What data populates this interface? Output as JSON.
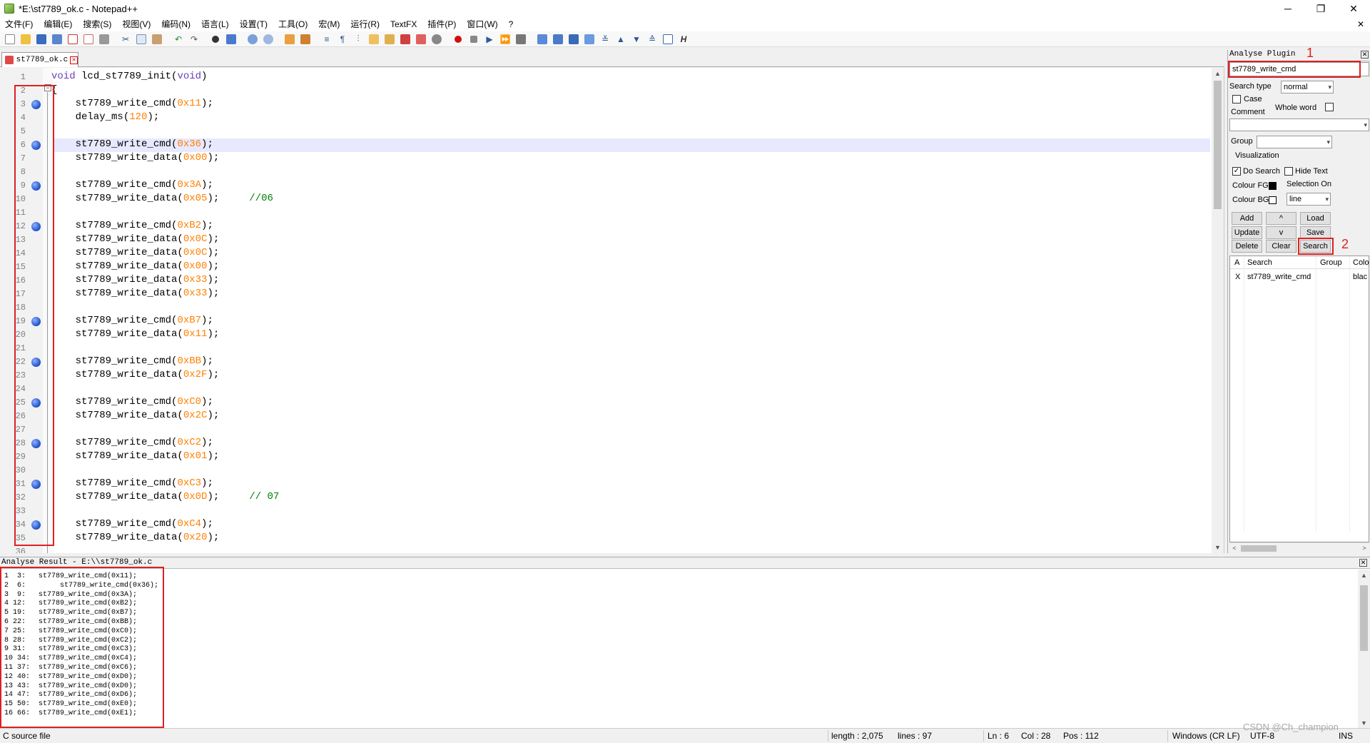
{
  "window": {
    "title": "*E:\\st7789_ok.c - Notepad++",
    "minimize": "─",
    "maximize": "❐",
    "close": "✕"
  },
  "menu": [
    "文件(F)",
    "编辑(E)",
    "搜索(S)",
    "视图(V)",
    "编码(N)",
    "语言(L)",
    "设置(T)",
    "工具(O)",
    "宏(M)",
    "运行(R)",
    "TextFX",
    "插件(P)",
    "窗口(W)",
    "?"
  ],
  "menu_close": "✕",
  "tab": {
    "label": "st7789_ok.c",
    "close": "✕"
  },
  "editor": {
    "fold_marker": "−",
    "lines": [
      {
        "n": "1",
        "code": [
          [
            "kw",
            "void"
          ],
          [
            "t",
            " lcd_st7789_init("
          ],
          [
            "kw",
            "void"
          ],
          [
            "t",
            ")"
          ]
        ]
      },
      {
        "n": "2",
        "code": [
          [
            "t",
            "{"
          ]
        ]
      },
      {
        "n": "3",
        "bm": true,
        "code": [
          [
            "t",
            "    st7789_write_cmd("
          ],
          [
            "num",
            "0x11"
          ],
          [
            "t",
            ");"
          ]
        ]
      },
      {
        "n": "4",
        "code": [
          [
            "t",
            "    delay_ms("
          ],
          [
            "num",
            "120"
          ],
          [
            "t",
            ");"
          ]
        ]
      },
      {
        "n": "5",
        "code": []
      },
      {
        "n": "6",
        "bm": true,
        "current": true,
        "code": [
          [
            "t",
            "    st7789_write_cmd("
          ],
          [
            "num",
            "0x36"
          ],
          [
            "t",
            ");"
          ]
        ]
      },
      {
        "n": "7",
        "code": [
          [
            "t",
            "    st7789_write_data("
          ],
          [
            "num",
            "0x00"
          ],
          [
            "t",
            ");"
          ]
        ]
      },
      {
        "n": "8",
        "code": []
      },
      {
        "n": "9",
        "bm": true,
        "code": [
          [
            "t",
            "    st7789_write_cmd("
          ],
          [
            "num",
            "0x3A"
          ],
          [
            "t",
            ");"
          ]
        ]
      },
      {
        "n": "10",
        "code": [
          [
            "t",
            "    st7789_write_data("
          ],
          [
            "num",
            "0x05"
          ],
          [
            "t",
            ");     "
          ],
          [
            "cm",
            "//06"
          ]
        ]
      },
      {
        "n": "11",
        "code": []
      },
      {
        "n": "12",
        "bm": true,
        "code": [
          [
            "t",
            "    st7789_write_cmd("
          ],
          [
            "num",
            "0xB2"
          ],
          [
            "t",
            ");"
          ]
        ]
      },
      {
        "n": "13",
        "code": [
          [
            "t",
            "    st7789_write_data("
          ],
          [
            "num",
            "0x0C"
          ],
          [
            "t",
            ");"
          ]
        ]
      },
      {
        "n": "14",
        "code": [
          [
            "t",
            "    st7789_write_data("
          ],
          [
            "num",
            "0x0C"
          ],
          [
            "t",
            ");"
          ]
        ]
      },
      {
        "n": "15",
        "code": [
          [
            "t",
            "    st7789_write_data("
          ],
          [
            "num",
            "0x00"
          ],
          [
            "t",
            ");"
          ]
        ]
      },
      {
        "n": "16",
        "code": [
          [
            "t",
            "    st7789_write_data("
          ],
          [
            "num",
            "0x33"
          ],
          [
            "t",
            ");"
          ]
        ]
      },
      {
        "n": "17",
        "code": [
          [
            "t",
            "    st7789_write_data("
          ],
          [
            "num",
            "0x33"
          ],
          [
            "t",
            ");"
          ]
        ]
      },
      {
        "n": "18",
        "code": []
      },
      {
        "n": "19",
        "bm": true,
        "code": [
          [
            "t",
            "    st7789_write_cmd("
          ],
          [
            "num",
            "0xB7"
          ],
          [
            "t",
            ");"
          ]
        ]
      },
      {
        "n": "20",
        "code": [
          [
            "t",
            "    st7789_write_data("
          ],
          [
            "num",
            "0x11"
          ],
          [
            "t",
            ");"
          ]
        ]
      },
      {
        "n": "21",
        "code": []
      },
      {
        "n": "22",
        "bm": true,
        "code": [
          [
            "t",
            "    st7789_write_cmd("
          ],
          [
            "num",
            "0xBB"
          ],
          [
            "t",
            ");"
          ]
        ]
      },
      {
        "n": "23",
        "code": [
          [
            "t",
            "    st7789_write_data("
          ],
          [
            "num",
            "0x2F"
          ],
          [
            "t",
            ");"
          ]
        ]
      },
      {
        "n": "24",
        "code": []
      },
      {
        "n": "25",
        "bm": true,
        "code": [
          [
            "t",
            "    st7789_write_cmd("
          ],
          [
            "num",
            "0xC0"
          ],
          [
            "t",
            ");"
          ]
        ]
      },
      {
        "n": "26",
        "code": [
          [
            "t",
            "    st7789_write_data("
          ],
          [
            "num",
            "0x2C"
          ],
          [
            "t",
            ");"
          ]
        ]
      },
      {
        "n": "27",
        "code": []
      },
      {
        "n": "28",
        "bm": true,
        "code": [
          [
            "t",
            "    st7789_write_cmd("
          ],
          [
            "num",
            "0xC2"
          ],
          [
            "t",
            ");"
          ]
        ]
      },
      {
        "n": "29",
        "code": [
          [
            "t",
            "    st7789_write_data("
          ],
          [
            "num",
            "0x01"
          ],
          [
            "t",
            ");"
          ]
        ]
      },
      {
        "n": "30",
        "code": []
      },
      {
        "n": "31",
        "bm": true,
        "code": [
          [
            "t",
            "    st7789_write_cmd("
          ],
          [
            "num",
            "0xC3"
          ],
          [
            "t",
            ");"
          ]
        ]
      },
      {
        "n": "32",
        "code": [
          [
            "t",
            "    st7789_write_data("
          ],
          [
            "num",
            "0x0D"
          ],
          [
            "t",
            ");     "
          ],
          [
            "cm",
            "// 07"
          ]
        ]
      },
      {
        "n": "33",
        "code": []
      },
      {
        "n": "34",
        "bm": true,
        "code": [
          [
            "t",
            "    st7789_write_cmd("
          ],
          [
            "num",
            "0xC4"
          ],
          [
            "t",
            ");"
          ]
        ]
      },
      {
        "n": "35",
        "code": [
          [
            "t",
            "    st7789_write_data("
          ],
          [
            "num",
            "0x20"
          ],
          [
            "t",
            ");"
          ]
        ]
      },
      {
        "n": "36",
        "code": []
      }
    ]
  },
  "plugin": {
    "title": "Analyse Plugin",
    "close": "✕",
    "search_value": "st7789_write_cmd",
    "search_type_label": "Search type",
    "search_type_value": "normal",
    "case_label": "Case",
    "whole_word_label": "Whole word",
    "comment_label": "Comment",
    "comment_value": "",
    "group_label": "Group",
    "group_value": "",
    "visualization_label": "Visualization",
    "do_search_label": "Do Search",
    "do_search_checked": "✓",
    "hide_text_label": "Hide Text",
    "colour_fg_label": "Colour FG",
    "colour_fg": "#000000",
    "selection_on_label": "Selection On",
    "colour_bg_label": "Colour BG",
    "colour_bg": "#ffffff",
    "selection_value": "line",
    "buttons": {
      "add": "Add",
      "up": "^",
      "load": "Load",
      "update": "Update",
      "down": "v",
      "save": "Save",
      "delete": "Delete",
      "clear": "Clear",
      "search": "Search"
    },
    "list_headers": {
      "a": "A",
      "search": "Search",
      "group": "Group",
      "colour": "Colo"
    },
    "list_rows": [
      {
        "a": "X",
        "search": "st7789_write_cmd",
        "group": "",
        "colour": "blac"
      }
    ],
    "scroll_left": "<",
    "scroll_right": ">",
    "annotation_1": "1",
    "annotation_2": "2"
  },
  "results": {
    "title": "Analyse Result - E:\\\\st7789_ok.c",
    "close": "✕",
    "rows": [
      "1  3:   st7789_write_cmd(0x11);",
      "2  6:        st7789_write_cmd(0x36);",
      "3  9:   st7789_write_cmd(0x3A);",
      "4 12:   st7789_write_cmd(0xB2);",
      "5 19:   st7789_write_cmd(0xB7);",
      "6 22:   st7789_write_cmd(0xBB);",
      "7 25:   st7789_write_cmd(0xC0);",
      "8 28:   st7789_write_cmd(0xC2);",
      "9 31:   st7789_write_cmd(0xC3);",
      "10 34:  st7789_write_cmd(0xC4);",
      "11 37:  st7789_write_cmd(0xC6);",
      "12 40:  st7789_write_cmd(0xD0);",
      "13 43:  st7789_write_cmd(0xD0);",
      "14 47:  st7789_write_cmd(0xD6);",
      "15 50:  st7789_write_cmd(0xE0);",
      "16 66:  st7789_write_cmd(0xE1);"
    ]
  },
  "status": {
    "filetype": "C source file",
    "length": "length : 2,075",
    "lines": "lines : 97",
    "ln": "Ln : 6",
    "col": "Col : 28",
    "pos": "Pos : 112",
    "eol": "Windows (CR LF)",
    "encoding": "UTF-8",
    "mode": "INS"
  },
  "watermark": "CSDN @Ch_champion",
  "scroll": {
    "up": "▲",
    "down": "▼"
  }
}
